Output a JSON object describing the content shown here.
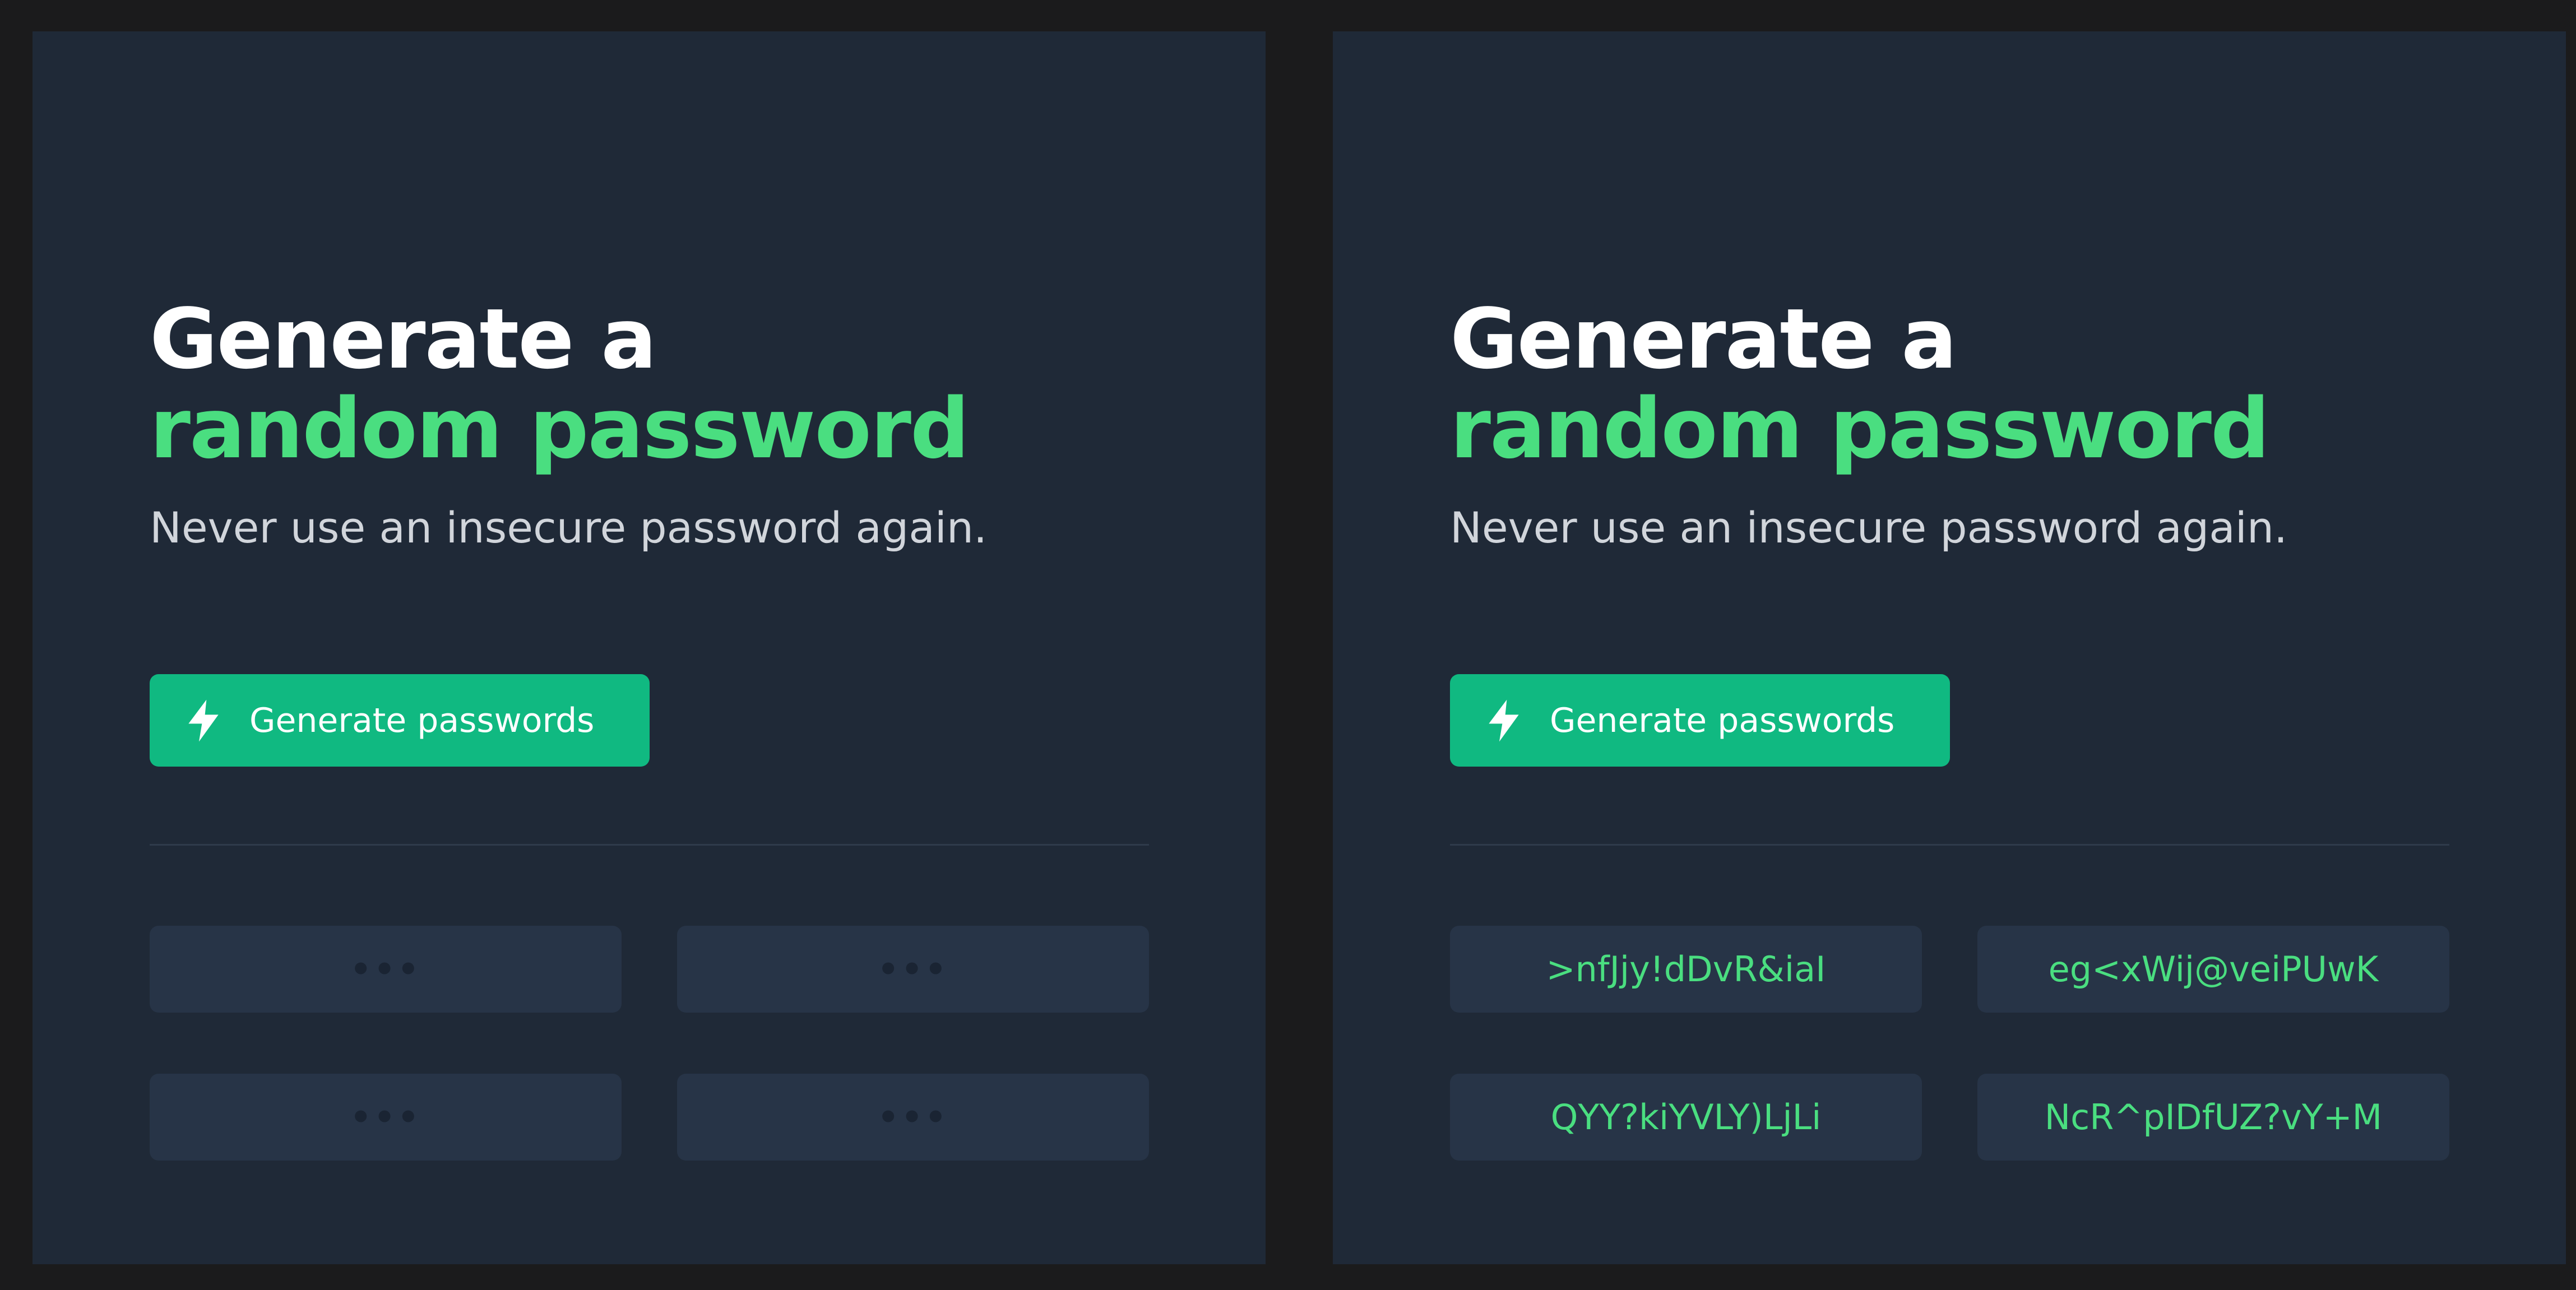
{
  "colors": {
    "page_background": "#1b1b1c",
    "panel_background": "#1f2937",
    "accent_green": "#4ade80",
    "button_green": "#10b981",
    "password_box": "#273447",
    "subtitle_text": "#d1d5db"
  },
  "panels": [
    {
      "state": "empty",
      "title_line1": "Generate a",
      "title_line2": "random password",
      "subtitle": "Never use an insecure password again.",
      "button": {
        "label": "Generate passwords",
        "icon": "bolt-icon"
      },
      "passwords": [
        "•••",
        "•••",
        "•••",
        "•••"
      ]
    },
    {
      "state": "generated",
      "title_line1": "Generate a",
      "title_line2": "random password",
      "subtitle": "Never use an insecure password again.",
      "button": {
        "label": "Generate passwords",
        "icon": "bolt-icon"
      },
      "passwords": [
        ">nfJjy!dDvR&iaI",
        "eg<xWij@veiPUwK",
        "QYY?kiYVLY)LjLi",
        "NcR^pIDfUZ?vY+M"
      ]
    }
  ]
}
